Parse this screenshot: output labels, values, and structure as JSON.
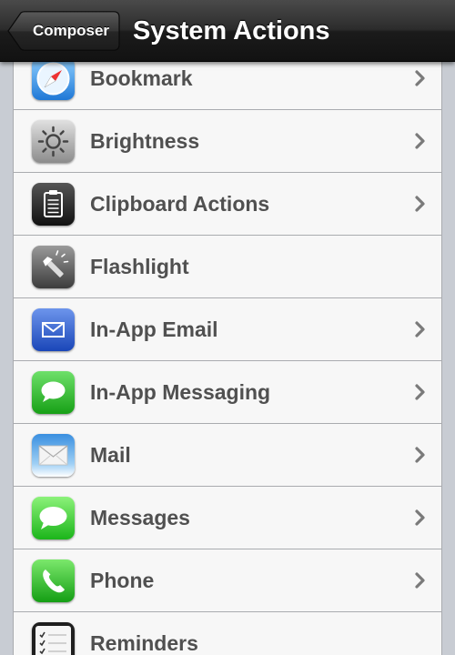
{
  "navbar": {
    "back_label": "Composer",
    "title": "System Actions"
  },
  "rows": [
    {
      "label": "Bookmark",
      "icon": "safari-compass-icon",
      "disclosure": true
    },
    {
      "label": "Brightness",
      "icon": "brightness-sun-icon",
      "disclosure": true
    },
    {
      "label": "Clipboard Actions",
      "icon": "clipboard-icon",
      "disclosure": true
    },
    {
      "label": "Flashlight",
      "icon": "flashlight-icon",
      "disclosure": false
    },
    {
      "label": "In-App Email",
      "icon": "email-envelope-icon",
      "disclosure": true
    },
    {
      "label": "In-App Messaging",
      "icon": "messaging-bubble-icon",
      "disclosure": true
    },
    {
      "label": "Mail",
      "icon": "mail-icon",
      "disclosure": true
    },
    {
      "label": "Messages",
      "icon": "messages-icon",
      "disclosure": true
    },
    {
      "label": "Phone",
      "icon": "phone-icon",
      "disclosure": true
    },
    {
      "label": "Reminders",
      "icon": "reminders-icon",
      "disclosure": false
    }
  ]
}
